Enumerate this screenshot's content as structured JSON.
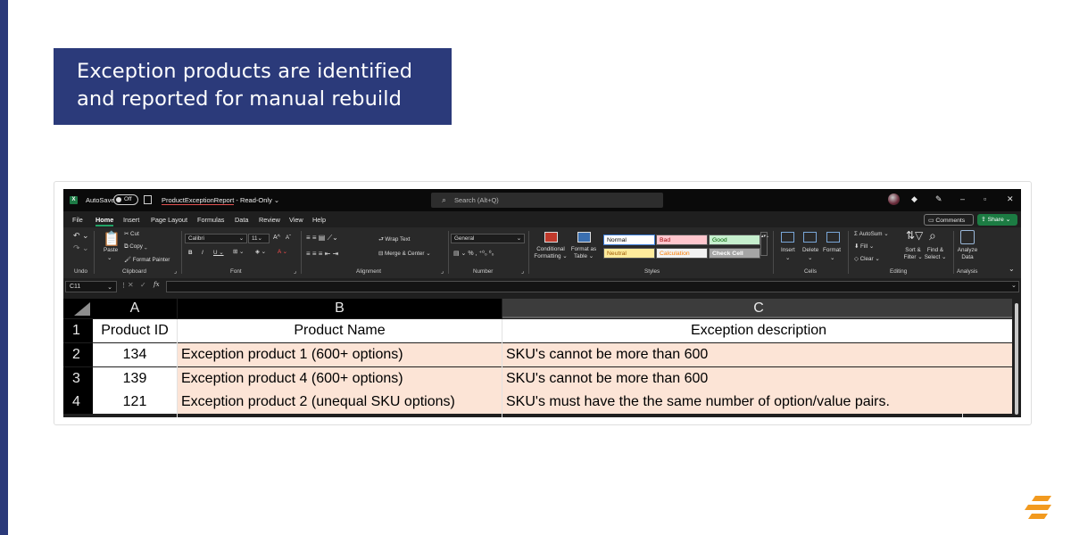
{
  "callout": {
    "line1": "Exception products are identified",
    "line2": "and reported for manual rebuild"
  },
  "colors": {
    "accent_navy": "#2b3a7a",
    "excel_green": "#21a366",
    "brand_orange": "#f29a1f",
    "highlight_fill": "#fce4d6"
  },
  "titlebar": {
    "autosave_label": "AutoSave",
    "autosave_state": "Off",
    "file_name": "ProductExceptionReport",
    "file_mode": "- Read-Only",
    "search_placeholder": "Search (Alt+Q)"
  },
  "menu": {
    "tabs": [
      "File",
      "Home",
      "Insert",
      "Page Layout",
      "Formulas",
      "Data",
      "Review",
      "View",
      "Help"
    ],
    "active_tab": "Home",
    "comments_label": "Comments",
    "share_label": "Share"
  },
  "ribbon": {
    "groups": [
      "Undo",
      "Clipboard",
      "Font",
      "Alignment",
      "Number",
      "Styles",
      "Cells",
      "Editing",
      "Analysis"
    ],
    "clipboard": {
      "paste": "Paste",
      "cut": "Cut",
      "copy": "Copy",
      "format_painter": "Format Painter"
    },
    "font": {
      "name": "Calibri",
      "size": "11"
    },
    "alignment": {
      "wrap_text": "Wrap Text",
      "merge_center": "Merge & Center"
    },
    "number": {
      "format": "General"
    },
    "styles": {
      "conditional_formatting": "Conditional Formatting",
      "format_as_table": "Format as Table",
      "cells": [
        {
          "label": "Normal",
          "bg": "#ffffff",
          "fg": "#000000"
        },
        {
          "label": "Bad",
          "bg": "#ffc7ce",
          "fg": "#9c0006"
        },
        {
          "label": "Good",
          "bg": "#c6efce",
          "fg": "#006100"
        },
        {
          "label": "Neutral",
          "bg": "#ffeb9c",
          "fg": "#9c5700"
        },
        {
          "label": "Calculation",
          "bg": "#f2f2f2",
          "fg": "#fa7d00"
        },
        {
          "label": "Check Cell",
          "bg": "#a5a5a5",
          "fg": "#ffffff"
        }
      ]
    },
    "cells": {
      "insert": "Insert",
      "delete": "Delete",
      "format": "Format"
    },
    "editing": {
      "autosum": "AutoSum",
      "fill": "Fill",
      "clear": "Clear",
      "sort_filter": "Sort & Filter",
      "find_select": "Find & Select"
    },
    "analysis": {
      "analyze_data": "Analyze Data"
    }
  },
  "formula_bar": {
    "name_box": "C11",
    "fx": "fx",
    "value": ""
  },
  "sheet": {
    "columns": [
      "A",
      "B",
      "C"
    ],
    "selected_column": "C",
    "rows": [
      {
        "num": "1",
        "a": "Product ID",
        "b": "Product Name",
        "c": "Exception description"
      },
      {
        "num": "2",
        "a": "134",
        "b": "Exception product 1 (600+ options)",
        "c": "SKU's cannot be more than 600"
      },
      {
        "num": "3",
        "a": "139",
        "b": "Exception product 4 (600+ options)",
        "c": "SKU's cannot be more than 600"
      },
      {
        "num": "4",
        "a": "121",
        "b": "Exception product 2 (unequal SKU options)",
        "c": "SKU's must have the the same number of option/value pairs."
      }
    ]
  }
}
